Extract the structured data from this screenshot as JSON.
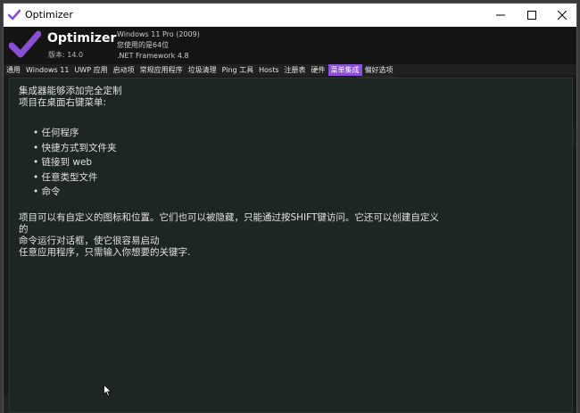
{
  "window": {
    "title": "Optimizer",
    "controls": {
      "minimize": "minimize-icon",
      "maximize": "maximize-icon",
      "close": "close-icon"
    }
  },
  "header": {
    "app_name": "Optimizer",
    "version": "版本: 14.0",
    "os": "Windows 11 Pro (2009)",
    "arch": "您使用的是64位",
    "framework": ".NET Framework 4.8"
  },
  "tabs": [
    {
      "label": "通用"
    },
    {
      "label": "Windows 11"
    },
    {
      "label": "UWP 应用"
    },
    {
      "label": "启动项"
    },
    {
      "label": "常规应用程序"
    },
    {
      "label": "垃圾清理"
    },
    {
      "label": "Ping 工具"
    },
    {
      "label": "Hosts"
    },
    {
      "label": "注册表"
    },
    {
      "label": "硬件"
    },
    {
      "label": "菜单集成",
      "active": true
    },
    {
      "label": "偏好选项"
    }
  ],
  "content": {
    "intro_line1": "集成器能够添加完全定制",
    "intro_line2": "项目在桌面右键菜单:",
    "items": [
      "任何程序",
      "快捷方式到文件夹",
      "链接到 web",
      "任意类型文件",
      "命令"
    ],
    "desc_line1": "项目可以有自定义的图标和位置。它们也可以被隐藏，只能通过按SHIFT键访问。它还可以创建自定义",
    "desc_line2": "的",
    "desc_line3": "命令运行对话框，使它很容易启动",
    "desc_line4": "任意应用程序，只需输入你想要的关键字."
  },
  "colors": {
    "accent": "#8a4fd6",
    "background": "#1b1b1b",
    "content_bg": "#1e2623"
  }
}
